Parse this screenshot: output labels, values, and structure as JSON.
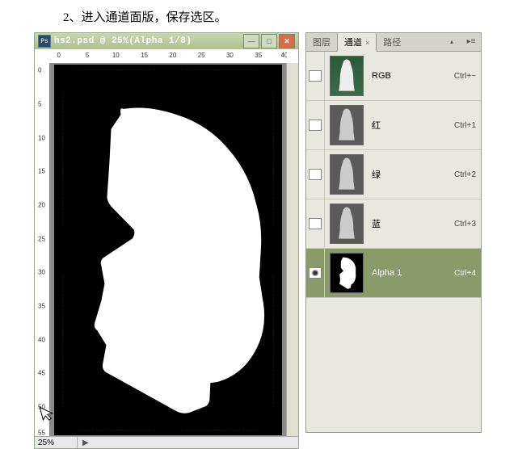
{
  "instruction_text": "2、进入通道面版，保存选区。",
  "doc": {
    "title": "hs2.psd @ 25%(Alpha 1/8)",
    "icon_label": "Ps",
    "zoom": "25%",
    "ruler_top": [
      "0",
      "5",
      "10",
      "15",
      "20",
      "25",
      "30",
      "35",
      "40"
    ],
    "ruler_left": [
      "0",
      "5",
      "10",
      "15",
      "20",
      "25",
      "30",
      "35",
      "40",
      "45",
      "50",
      "55"
    ]
  },
  "panel": {
    "tabs": {
      "layers": "图层",
      "channels": "通道",
      "paths": "路径"
    },
    "channels": [
      {
        "name": "RGB",
        "shortcut": "Ctrl+~",
        "thumb": "rgb",
        "visible": false,
        "selected": false
      },
      {
        "name": "红",
        "shortcut": "Ctrl+1",
        "thumb": "gray",
        "visible": false,
        "selected": false
      },
      {
        "name": "绿",
        "shortcut": "Ctrl+2",
        "thumb": "gray",
        "visible": false,
        "selected": false
      },
      {
        "name": "蓝",
        "shortcut": "Ctrl+3",
        "thumb": "gray",
        "visible": false,
        "selected": false
      },
      {
        "name": "Alpha 1",
        "shortcut": "Ctrl+4",
        "thumb": "mask",
        "visible": true,
        "selected": true
      }
    ]
  }
}
